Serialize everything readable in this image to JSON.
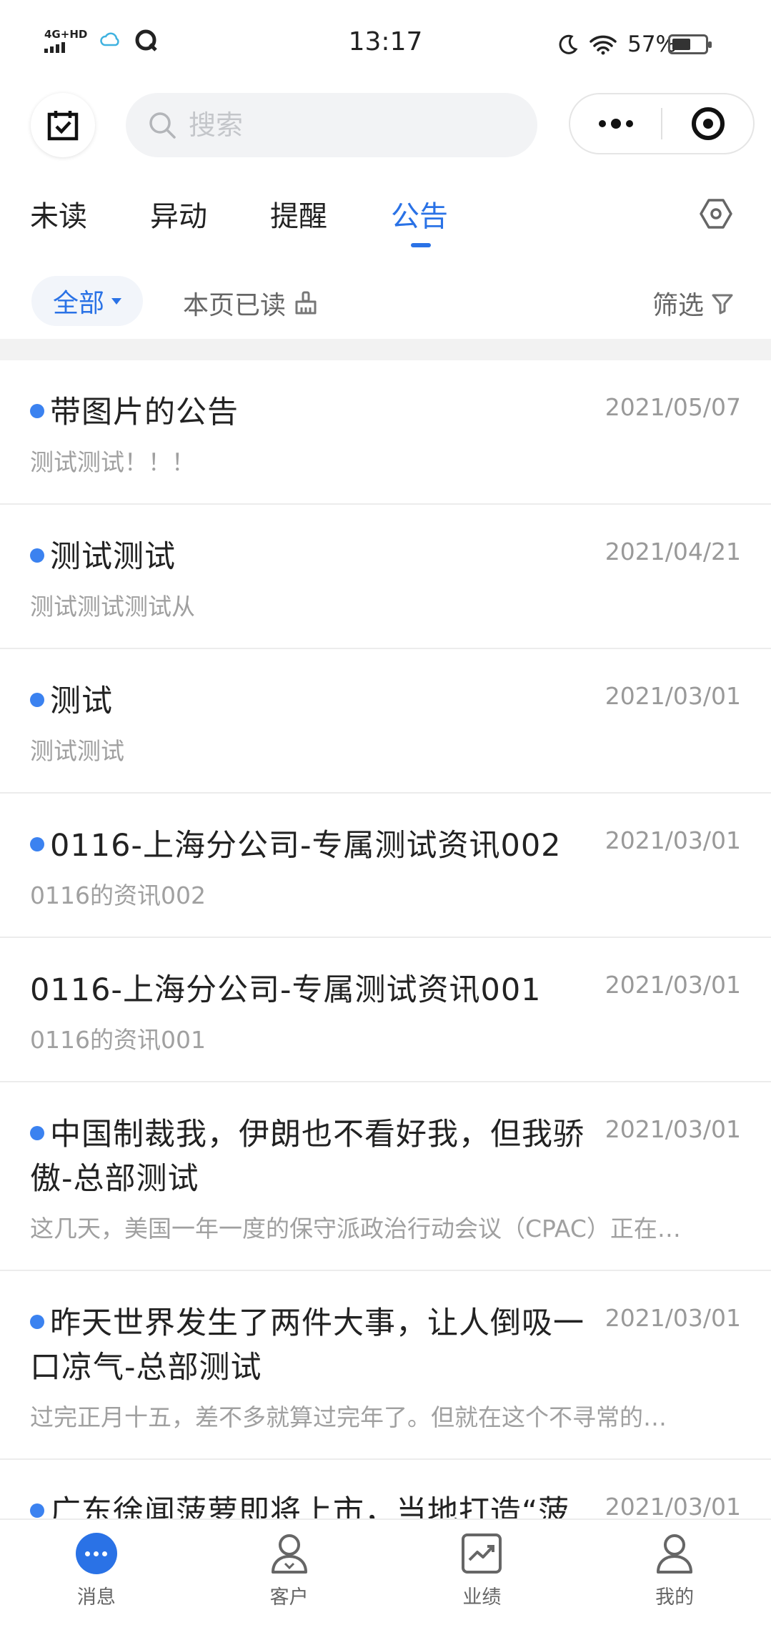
{
  "status_bar": {
    "network": "4G+HD",
    "time": "13:17",
    "battery": "57%",
    "battery_level": 0.57
  },
  "header": {
    "calendar_icon": "calendar-check-icon",
    "search_placeholder": "搜索"
  },
  "tabs": [
    {
      "label": "未读",
      "active": false
    },
    {
      "label": "异动",
      "active": false
    },
    {
      "label": "提醒",
      "active": false
    },
    {
      "label": "公告",
      "active": true
    }
  ],
  "filters": {
    "scope": "全部",
    "mark_read": "本页已读",
    "filter": "筛选"
  },
  "colors": {
    "accent": "#2a72e6",
    "unread_dot": "#3b82f0"
  },
  "announcements": [
    {
      "title": "带图片的公告",
      "date": "2021/05/07",
      "summary": "测试测试！！！",
      "unread": true
    },
    {
      "title": "测试测试",
      "date": "2021/04/21",
      "summary": "测试测试测试从",
      "unread": true
    },
    {
      "title": "测试",
      "date": "2021/03/01",
      "summary": "测试测试",
      "unread": true
    },
    {
      "title": "0116-上海分公司-专属测试资讯002",
      "date": "2021/03/01",
      "summary": "0116的资讯002",
      "unread": true
    },
    {
      "title": "0116-上海分公司-专属测试资讯001",
      "date": "2021/03/01",
      "summary": "0116的资讯001",
      "unread": false
    },
    {
      "title": "中国制裁我，伊朗也不看好我，但我骄傲-总部测试",
      "date": "2021/03/01",
      "summary": "这几天，美国一年一度的保守派政治行动会议（CPAC）正在…",
      "unread": true
    },
    {
      "title": "昨天世界发生了两件大事，让人倒吸一口凉气-总部测试",
      "date": "2021/03/01",
      "summary": "过完正月十五，差不多就算过完年了。但就在这个不寻常的…",
      "unread": true
    },
    {
      "title": "广东徐闻菠萝即将上市，当地打造“菠萝专列”发送出省-总部测试",
      "date": "2021/03/01",
      "summary": "",
      "unread": true
    }
  ],
  "bottom_nav": [
    {
      "label": "消息",
      "icon": "message-icon",
      "active": true
    },
    {
      "label": "客户",
      "icon": "customer-icon",
      "active": false
    },
    {
      "label": "业绩",
      "icon": "performance-icon",
      "active": false
    },
    {
      "label": "我的",
      "icon": "profile-icon",
      "active": false
    }
  ]
}
